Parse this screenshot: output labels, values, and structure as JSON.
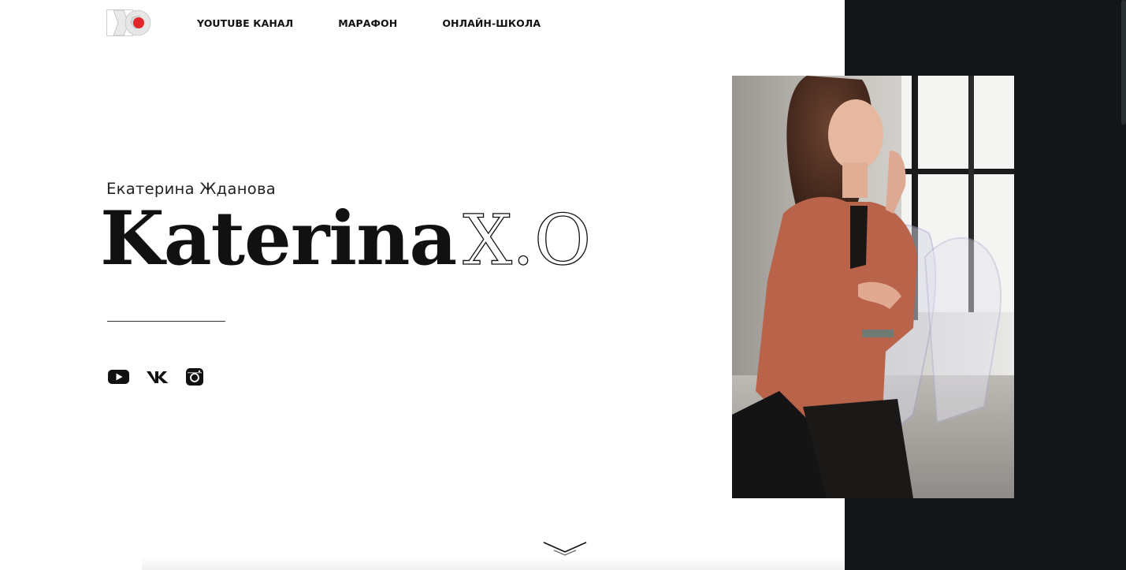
{
  "nav": {
    "items": [
      {
        "label": "YOUTUBE КАНАЛ"
      },
      {
        "label": "МАРАФОН"
      },
      {
        "label": "ОНЛАЙН-ШКОЛА"
      }
    ]
  },
  "hero": {
    "subtitle": "Екатерина Жданова",
    "title_bold": "Katerina",
    "title_outline": "X.O"
  },
  "socials": [
    {
      "icon": "youtube-icon"
    },
    {
      "icon": "vk-icon"
    },
    {
      "icon": "instagram-icon"
    }
  ],
  "colors": {
    "dark_panel": "#121617",
    "text": "#111111",
    "logo_accent": "#e0262b"
  }
}
